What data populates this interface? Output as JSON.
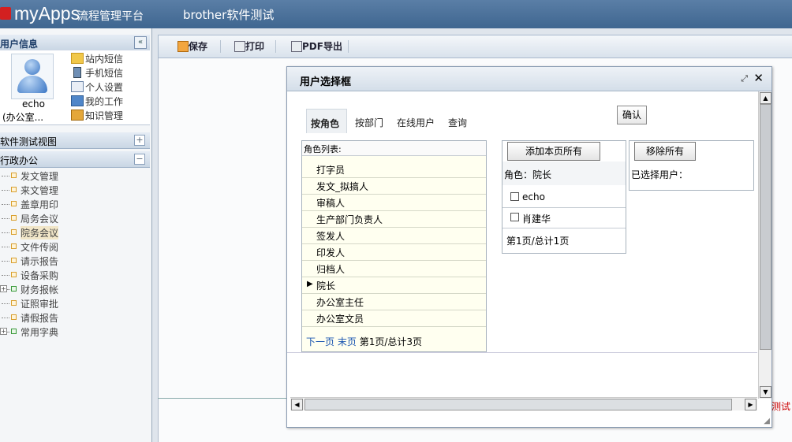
{
  "header": {
    "logo_text": "myApps",
    "logo_sub": "流程管理平台",
    "app_title": "brother软件测试"
  },
  "left_panel": {
    "user_info_title": "用户信息",
    "user_name": "echo",
    "user_org": "(办公室...",
    "collapse_icon": "«",
    "links": [
      {
        "label": "站内短信",
        "icon": "envelope-icon"
      },
      {
        "label": "手机短信",
        "icon": "mobile-icon"
      },
      {
        "label": "个人设置",
        "icon": "settings-pen-icon"
      },
      {
        "label": "我的工作",
        "icon": "work-icon"
      },
      {
        "label": "知识管理",
        "icon": "knowledge-icon"
      }
    ],
    "section_view": "软件测试视图",
    "section_office": "行政办公",
    "plus_sign": "+",
    "minus_sign": "−",
    "tree_items": [
      {
        "label": "发文管理"
      },
      {
        "label": "来文管理"
      },
      {
        "label": "盖章用印"
      },
      {
        "label": "局务会议"
      },
      {
        "label": "院务会议"
      },
      {
        "label": "文件传阅"
      },
      {
        "label": "请示报告"
      },
      {
        "label": "设备采购"
      },
      {
        "label": "财务报帐"
      },
      {
        "label": "证照审批"
      },
      {
        "label": "请假报告"
      },
      {
        "label": "常用字典"
      }
    ]
  },
  "toolbar": {
    "save_label": "保存",
    "print_label": "打印",
    "pdf_label": "PDF导出"
  },
  "content": {
    "right_red_text": "测试"
  },
  "dialog": {
    "title": "用户选择框",
    "max_icon": "⤢",
    "close_icon": "✕",
    "tabs": [
      {
        "label": "按角色"
      },
      {
        "label": "按部门"
      },
      {
        "label": "在线用户"
      },
      {
        "label": "查询"
      }
    ],
    "confirm_label": "确认",
    "role_list_header": "角色列表:",
    "roles": [
      {
        "label": "打字员"
      },
      {
        "label": "发文_拟搞人"
      },
      {
        "label": "审稿人"
      },
      {
        "label": "生产部门负责人"
      },
      {
        "label": "签发人"
      },
      {
        "label": "印发人"
      },
      {
        "label": "归档人"
      },
      {
        "label": "院长"
      },
      {
        "label": "办公室主任"
      },
      {
        "label": "办公室文员"
      }
    ],
    "selected_marker": "▶",
    "pager_next": "下一页",
    "pager_last": "末页",
    "pager_info": "第1页/总计3页",
    "add_all_label": "添加本页所有",
    "current_role_label": "角色：院长",
    "users": [
      {
        "label": "echo"
      },
      {
        "label": "肖建华"
      }
    ],
    "users_pager": "第1页/总计1页",
    "remove_all_label": "移除所有",
    "selected_users_label": "已选择用户：",
    "scroll_up": "▲",
    "scroll_down": "▼",
    "scroll_left": "◀",
    "scroll_right": "▶",
    "resize_grip": "◢"
  }
}
